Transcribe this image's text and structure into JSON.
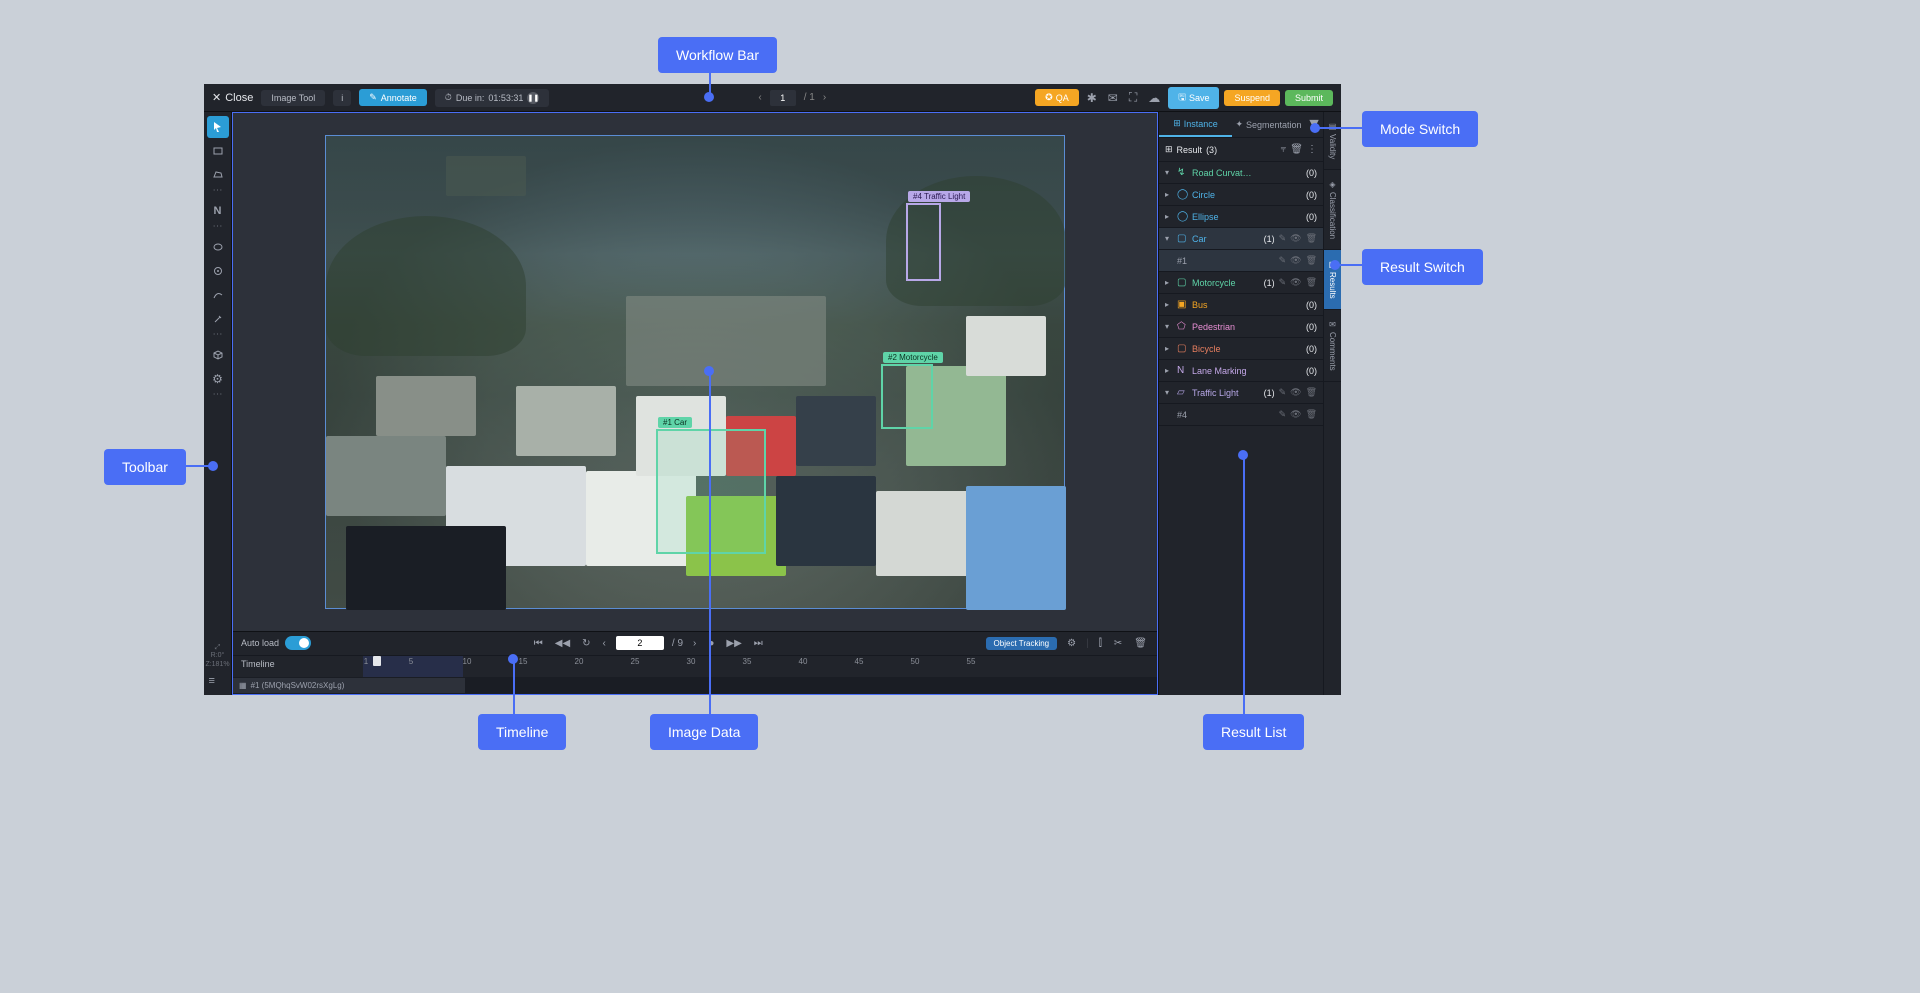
{
  "callouts": {
    "workflow_bar": "Workflow Bar",
    "mode_switch": "Mode Switch",
    "result_switch": "Result Switch",
    "toolbar": "Toolbar",
    "timeline": "Timeline",
    "image_data": "Image Data",
    "result_list": "Result List"
  },
  "header": {
    "close": "Close",
    "tool": "Image Tool",
    "annotate": "Annotate",
    "due_prefix": "Due in:",
    "due_time": "01:53:31",
    "page": "1",
    "page_sep": "/ 1",
    "qa": "QA",
    "save": "Save",
    "suspend": "Suspend",
    "submit": "Submit"
  },
  "toolbar_info": {
    "r": "R:0°",
    "z": "Z:181%"
  },
  "annotations": {
    "car": "#1  Car",
    "motorcycle": "#2  Motorcycle",
    "traffic_light": "#4  Traffic Light"
  },
  "timeline": {
    "auto_load": "Auto load",
    "frame": "2",
    "total": "/ 9",
    "tracking": "Object Tracking",
    "label": "Timeline",
    "ticks": [
      "1",
      "5",
      "10",
      "15",
      "20",
      "25",
      "30",
      "35",
      "40",
      "45",
      "50",
      "55"
    ],
    "track_row": "#1 (5MQhqSvW02rsXgLg)"
  },
  "panel": {
    "instance": "Instance",
    "segmentation": "Segmentation",
    "result_label": "Result",
    "result_count": "(3)",
    "items": [
      {
        "name": "Road Curvat…",
        "count": "(0)",
        "color": "#5fd4a8",
        "icon": "↯",
        "expanded": true
      },
      {
        "name": "Circle",
        "count": "(0)",
        "color": "#4fb3e8",
        "icon": "◯",
        "expanded": false
      },
      {
        "name": "Ellipse",
        "count": "(0)",
        "color": "#4fb3e8",
        "icon": "◯",
        "expanded": false
      },
      {
        "name": "Car",
        "count": "(1)",
        "color": "#4fb3e8",
        "icon": "▢",
        "expanded": true,
        "selected": true,
        "actions": true,
        "children": [
          {
            "name": "#1",
            "actions": true,
            "selected": true
          }
        ]
      },
      {
        "name": "Motorcycle",
        "count": "(1)",
        "color": "#5fd4a8",
        "icon": "▢",
        "expanded": false,
        "actions": true
      },
      {
        "name": "Bus",
        "count": "(0)",
        "color": "#f5a623",
        "icon": "▣",
        "expanded": false
      },
      {
        "name": "Pedestrian",
        "count": "(0)",
        "color": "#e88fd4",
        "icon": "⬠",
        "expanded": true
      },
      {
        "name": "Bicycle",
        "count": "(0)",
        "color": "#e87f5f",
        "icon": "▢",
        "expanded": false
      },
      {
        "name": "Lane Marking",
        "count": "(0)",
        "color": "#c4a8e8",
        "icon": "N",
        "expanded": false
      },
      {
        "name": "Traffic Light",
        "count": "(1)",
        "color": "#b8a8e8",
        "icon": "▱",
        "expanded": true,
        "actions": true,
        "children": [
          {
            "name": "#4",
            "actions": true
          }
        ]
      }
    ],
    "side_tabs": [
      "Validity",
      "Classification",
      "Results",
      "Comments"
    ]
  }
}
